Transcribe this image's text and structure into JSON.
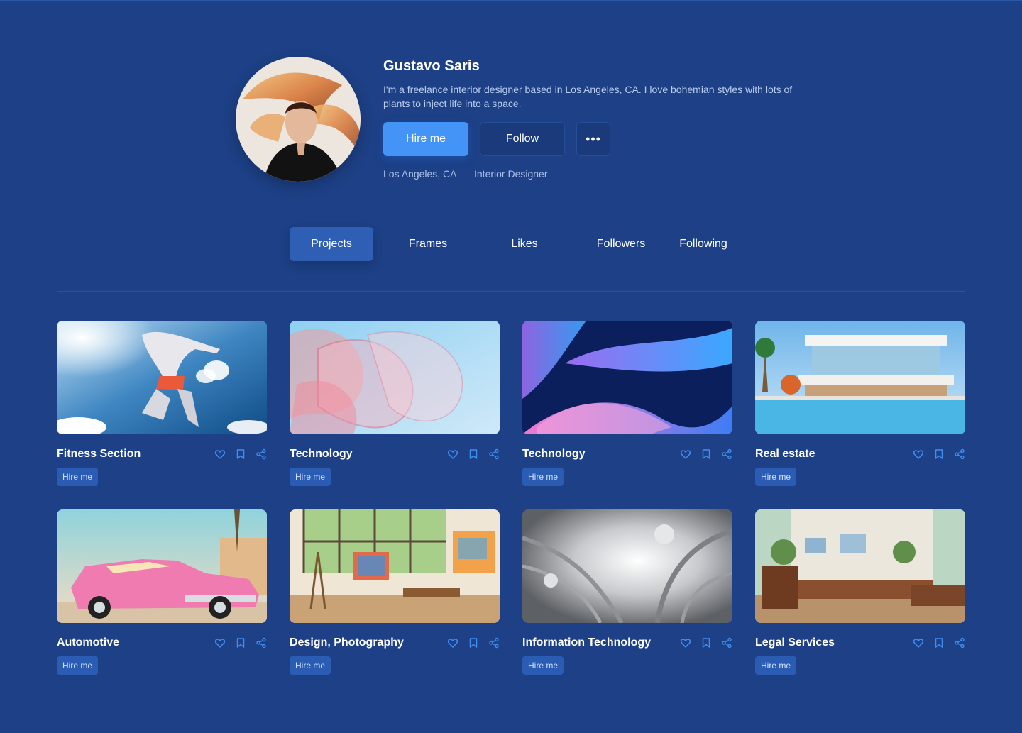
{
  "profile": {
    "name": "Gustavo Saris",
    "bio": "I'm a freelance interior designer based in Los Angeles, CA. I love bohemian styles with lots of plants to inject life into a space.",
    "location": "Los Angeles, CA",
    "role": "Interior Designer",
    "hire_label": "Hire me",
    "follow_label": "Follow",
    "more_label": "•••"
  },
  "tabs": [
    "Projects",
    "Frames",
    "Likes",
    "Followers",
    "Following"
  ],
  "active_tab": "Projects",
  "colors": {
    "background": "#1d4086",
    "accent": "#4394f6",
    "icon": "#3f8ef0"
  },
  "cards": [
    {
      "title": "Fitness Section",
      "tag": "Hire me",
      "image": "athlete-jumping-sky"
    },
    {
      "title": "Technology",
      "tag": "Hire me",
      "image": "glass-ribbons-pink"
    },
    {
      "title": "Technology",
      "tag": "Hire me",
      "image": "blue-waves-abstract"
    },
    {
      "title": "Real estate",
      "tag": "Hire me",
      "image": "modern-villa-pool"
    },
    {
      "title": "Automotive",
      "tag": "Hire me",
      "image": "pink-classic-car"
    },
    {
      "title": "Design, Photography",
      "tag": "Hire me",
      "image": "art-studio-interior"
    },
    {
      "title": "Information Technology",
      "tag": "Hire me",
      "image": "silver-cables-tunnel"
    },
    {
      "title": "Legal Services",
      "tag": "Hire me",
      "image": "living-room-interior"
    }
  ],
  "card_icons": [
    "heart-icon",
    "bookmark-icon",
    "share-icon"
  ]
}
